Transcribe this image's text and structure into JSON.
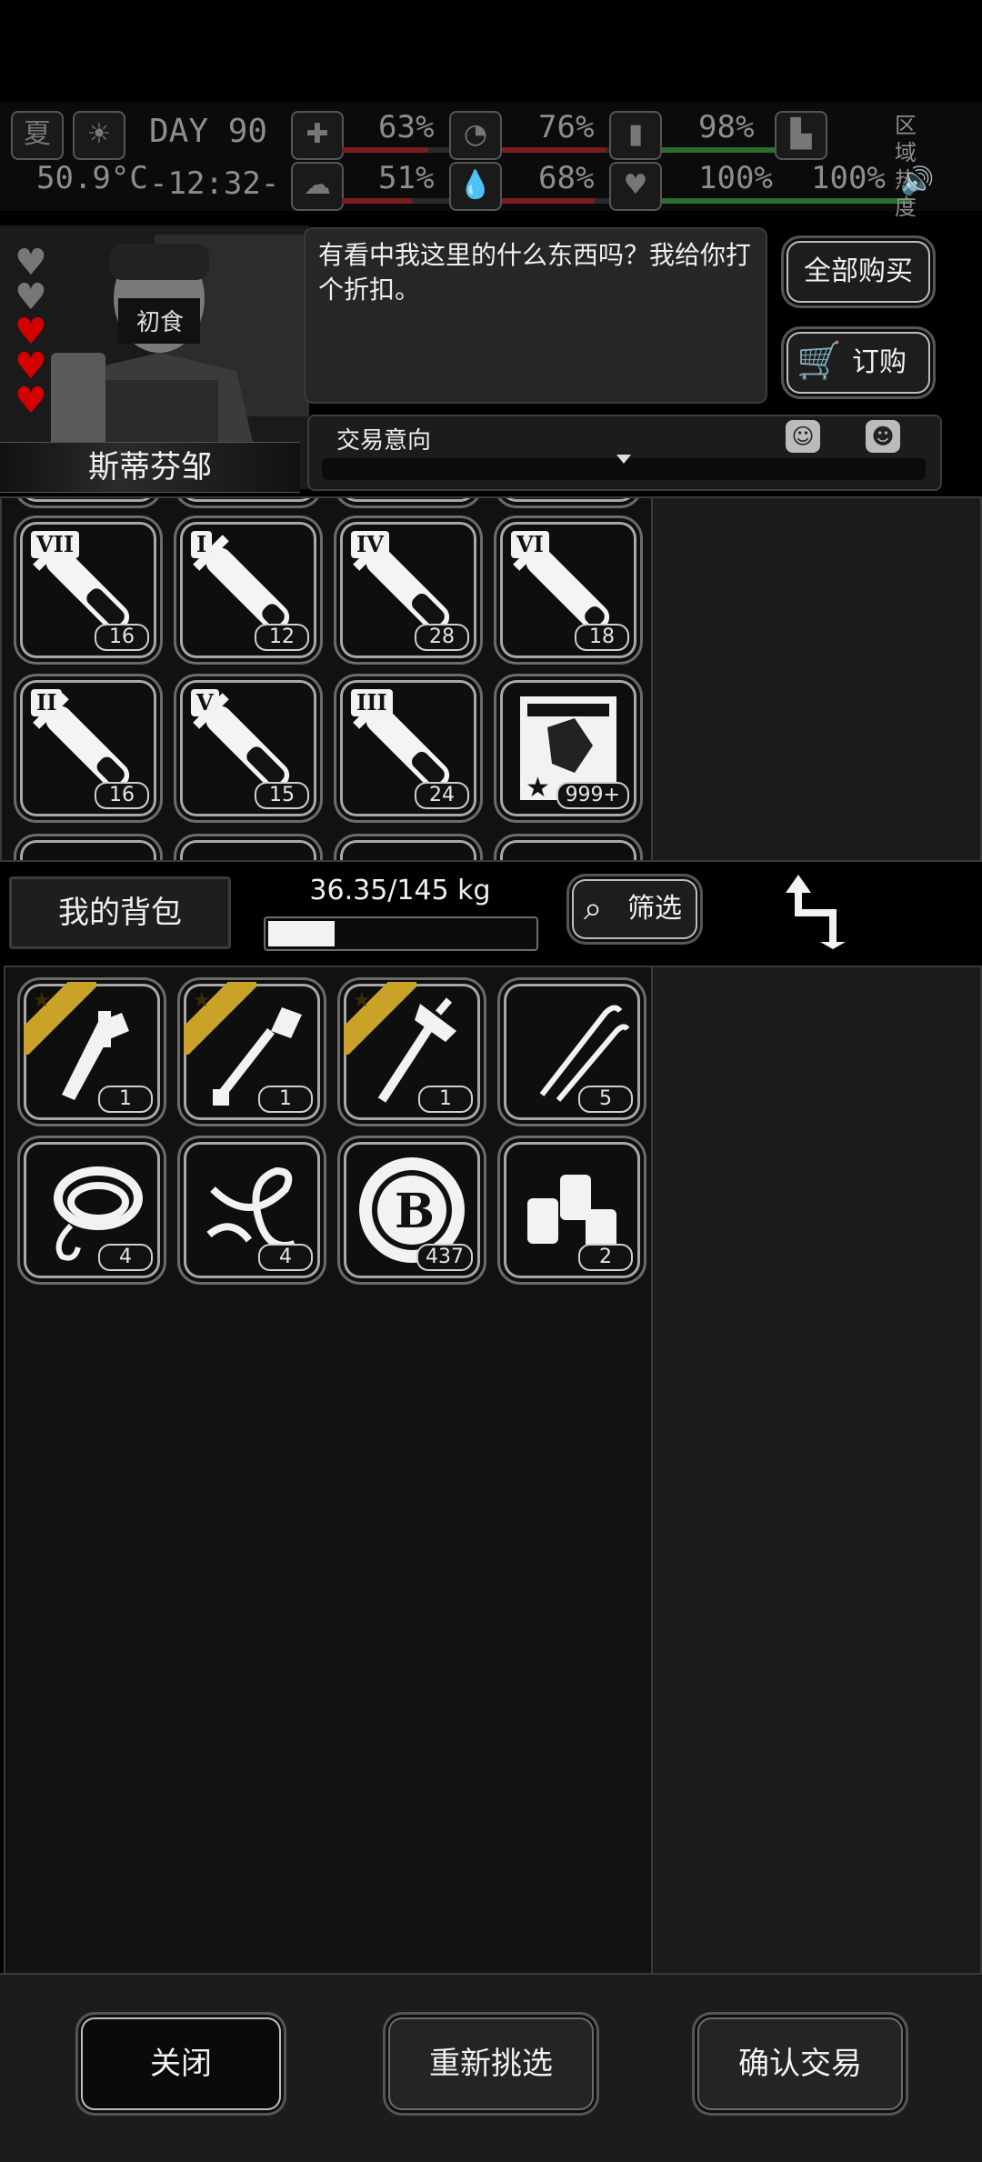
{
  "status": {
    "season": "夏",
    "day_label": "DAY",
    "day": "90",
    "temperature": "50.9°C",
    "clock": "-12:32-",
    "stats": [
      {
        "name": "health",
        "icon": "medkit-icon",
        "value": "63%",
        "level": 0.63
      },
      {
        "name": "hunger",
        "icon": "stomach-icon",
        "value": "76%",
        "level": 0.76
      },
      {
        "name": "energy",
        "icon": "battery-icon",
        "value": "98%",
        "level": 0.98
      },
      {
        "name": "mood",
        "icon": "brain-icon",
        "value": "51%",
        "level": 0.51
      },
      {
        "name": "thirst",
        "icon": "water-drop-icon",
        "value": "68%",
        "level": 0.68
      },
      {
        "name": "heart",
        "icon": "heart-icon",
        "value": "100%",
        "level": 1.0
      },
      {
        "name": "stamina",
        "icon": "boot-icon",
        "value": "100%",
        "level": 1.0
      }
    ],
    "area_heat": "区域热度"
  },
  "trader": {
    "name": "斯蒂芬邹",
    "hearts_filled": 3,
    "hearts_total": 5,
    "dialogue": "有看中我这里的什么东西吗？我给你打个折扣。",
    "buy_all_label": "全部购买",
    "order_label": "订购",
    "intent_label": "交易意向",
    "intent_level": 0.5
  },
  "shop_items": [
    {
      "tier": "VII",
      "kind": "vial",
      "fill": 0.55,
      "qty": "16"
    },
    {
      "tier": "I",
      "kind": "vial",
      "fill": 0.25,
      "qty": "12"
    },
    {
      "tier": "IV",
      "kind": "vial",
      "fill": 0.45,
      "qty": "28"
    },
    {
      "tier": "VI",
      "kind": "vial",
      "fill": 0.2,
      "qty": "18"
    },
    {
      "tier": "II",
      "kind": "vial",
      "fill": 0.35,
      "qty": "16"
    },
    {
      "tier": "V",
      "kind": "vial",
      "fill": 0.55,
      "qty": "15"
    },
    {
      "tier": "III",
      "kind": "vial",
      "fill": 0.45,
      "qty": "24"
    },
    {
      "tier": "",
      "kind": "card",
      "fill": 0,
      "qty": "999+"
    }
  ],
  "backpack": {
    "label": "我的背包",
    "weight": "36.35/145 kg",
    "weight_level": 0.2507,
    "filter_label": "筛选",
    "items": [
      {
        "kind": "multitool",
        "starred": true,
        "qty": "1"
      },
      {
        "kind": "shovel",
        "starred": true,
        "qty": "1"
      },
      {
        "kind": "axe",
        "starred": true,
        "qty": "1"
      },
      {
        "kind": "lockpick",
        "starred": false,
        "qty": "5"
      },
      {
        "kind": "rope-hook",
        "starred": false,
        "qty": "4"
      },
      {
        "kind": "rope",
        "starred": false,
        "qty": "4"
      },
      {
        "kind": "coin",
        "starred": false,
        "qty": "437"
      },
      {
        "kind": "cans",
        "starred": false,
        "qty": "2"
      }
    ]
  },
  "footer": {
    "close_label": "关闭",
    "reselect_label": "重新挑选",
    "confirm_label": "确认交易"
  },
  "colors": {
    "accent": "#c9a227",
    "heart": "#d40000"
  }
}
